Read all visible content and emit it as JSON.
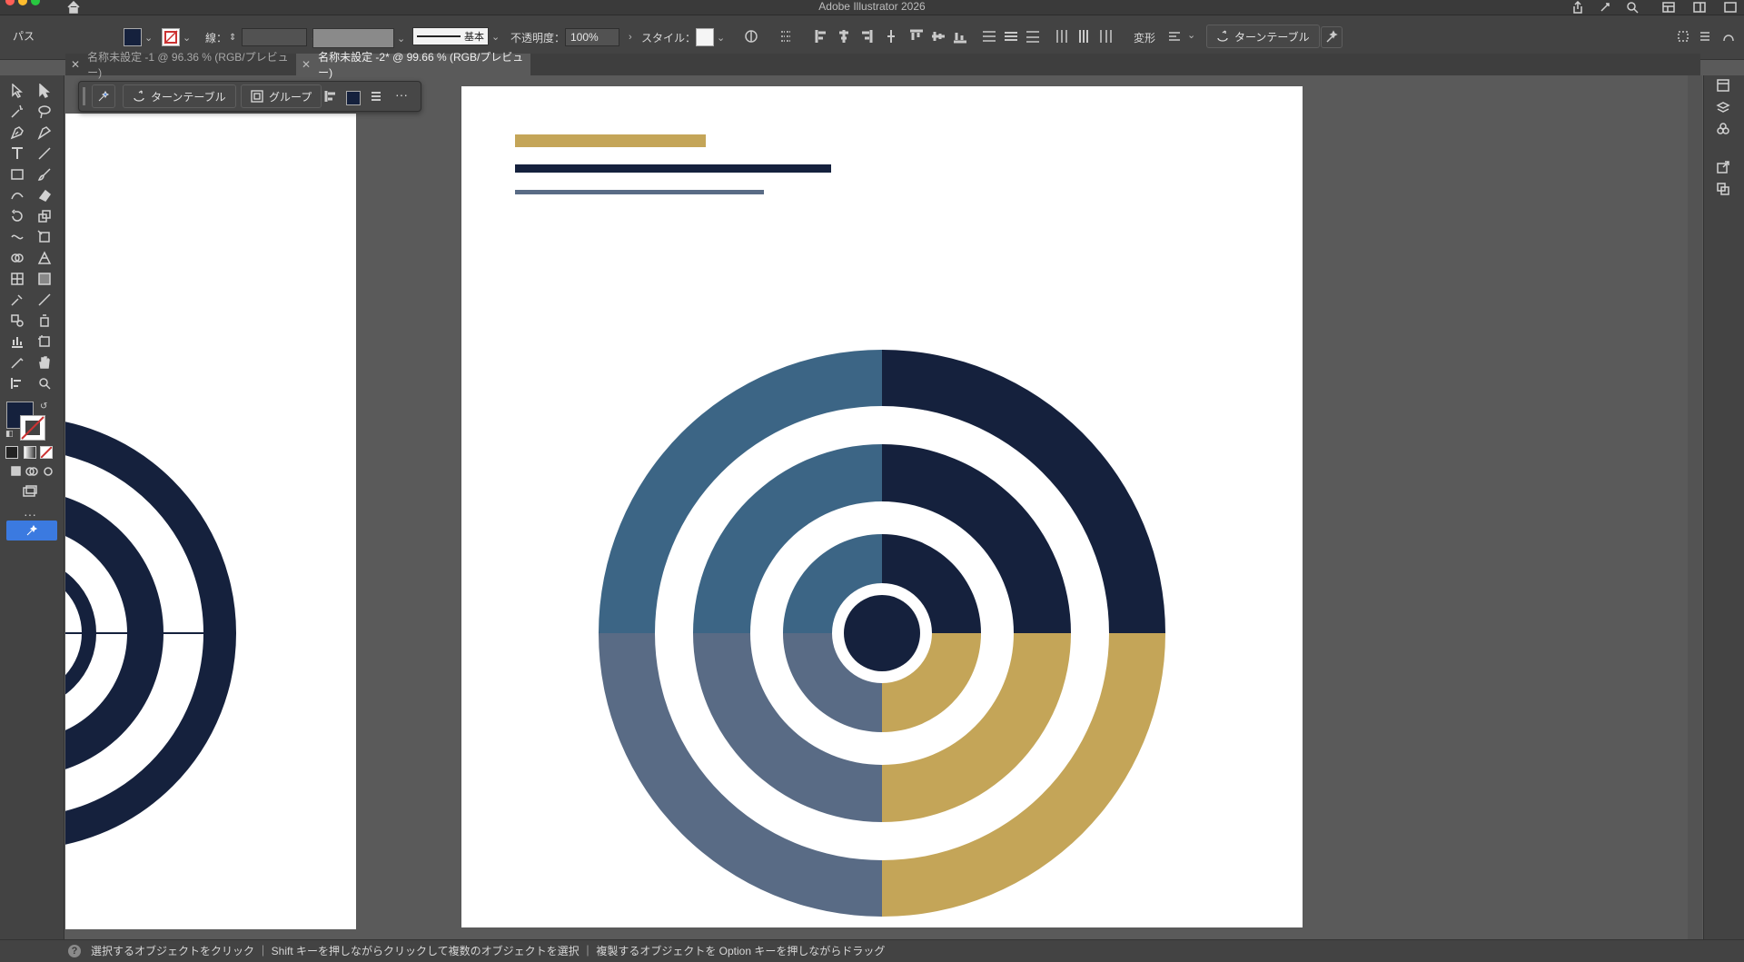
{
  "app": {
    "title": "Adobe Illustrator 2026"
  },
  "controlbar": {
    "selection_type": "パス",
    "stroke_label": "線：",
    "stroke_profile": "基本",
    "opacity_label": "不透明度：",
    "opacity_value": "100%",
    "style_label": "スタイル：",
    "transform_label": "変形",
    "turntable_label": "ターンテーブル"
  },
  "tabs": [
    {
      "label": "名称未設定 -1 @ 96.36 % (RGB/プレビュー)",
      "active": false
    },
    {
      "label": "名称未設定 -2* @ 99.66 % (RGB/プレビュー)",
      "active": true
    }
  ],
  "context_bar": {
    "turntable_label": "ターンテーブル",
    "group_label": "グループ"
  },
  "colors": {
    "navy": "#15213d",
    "steel_blue": "#3c6585",
    "slate": "#596b85",
    "gold": "#c4a558",
    "white": "#ffffff"
  },
  "icons": {
    "home": "home-icon",
    "share": "share-icon",
    "search": "search-icon"
  },
  "status_bar": {
    "text": "選択するオブジェクトをクリック ｜ Shift キーを押しながらクリックして複数のオブジェクトを選択 ｜ 複製するオブジェクトを Option キーを押しながらドラッグ"
  }
}
